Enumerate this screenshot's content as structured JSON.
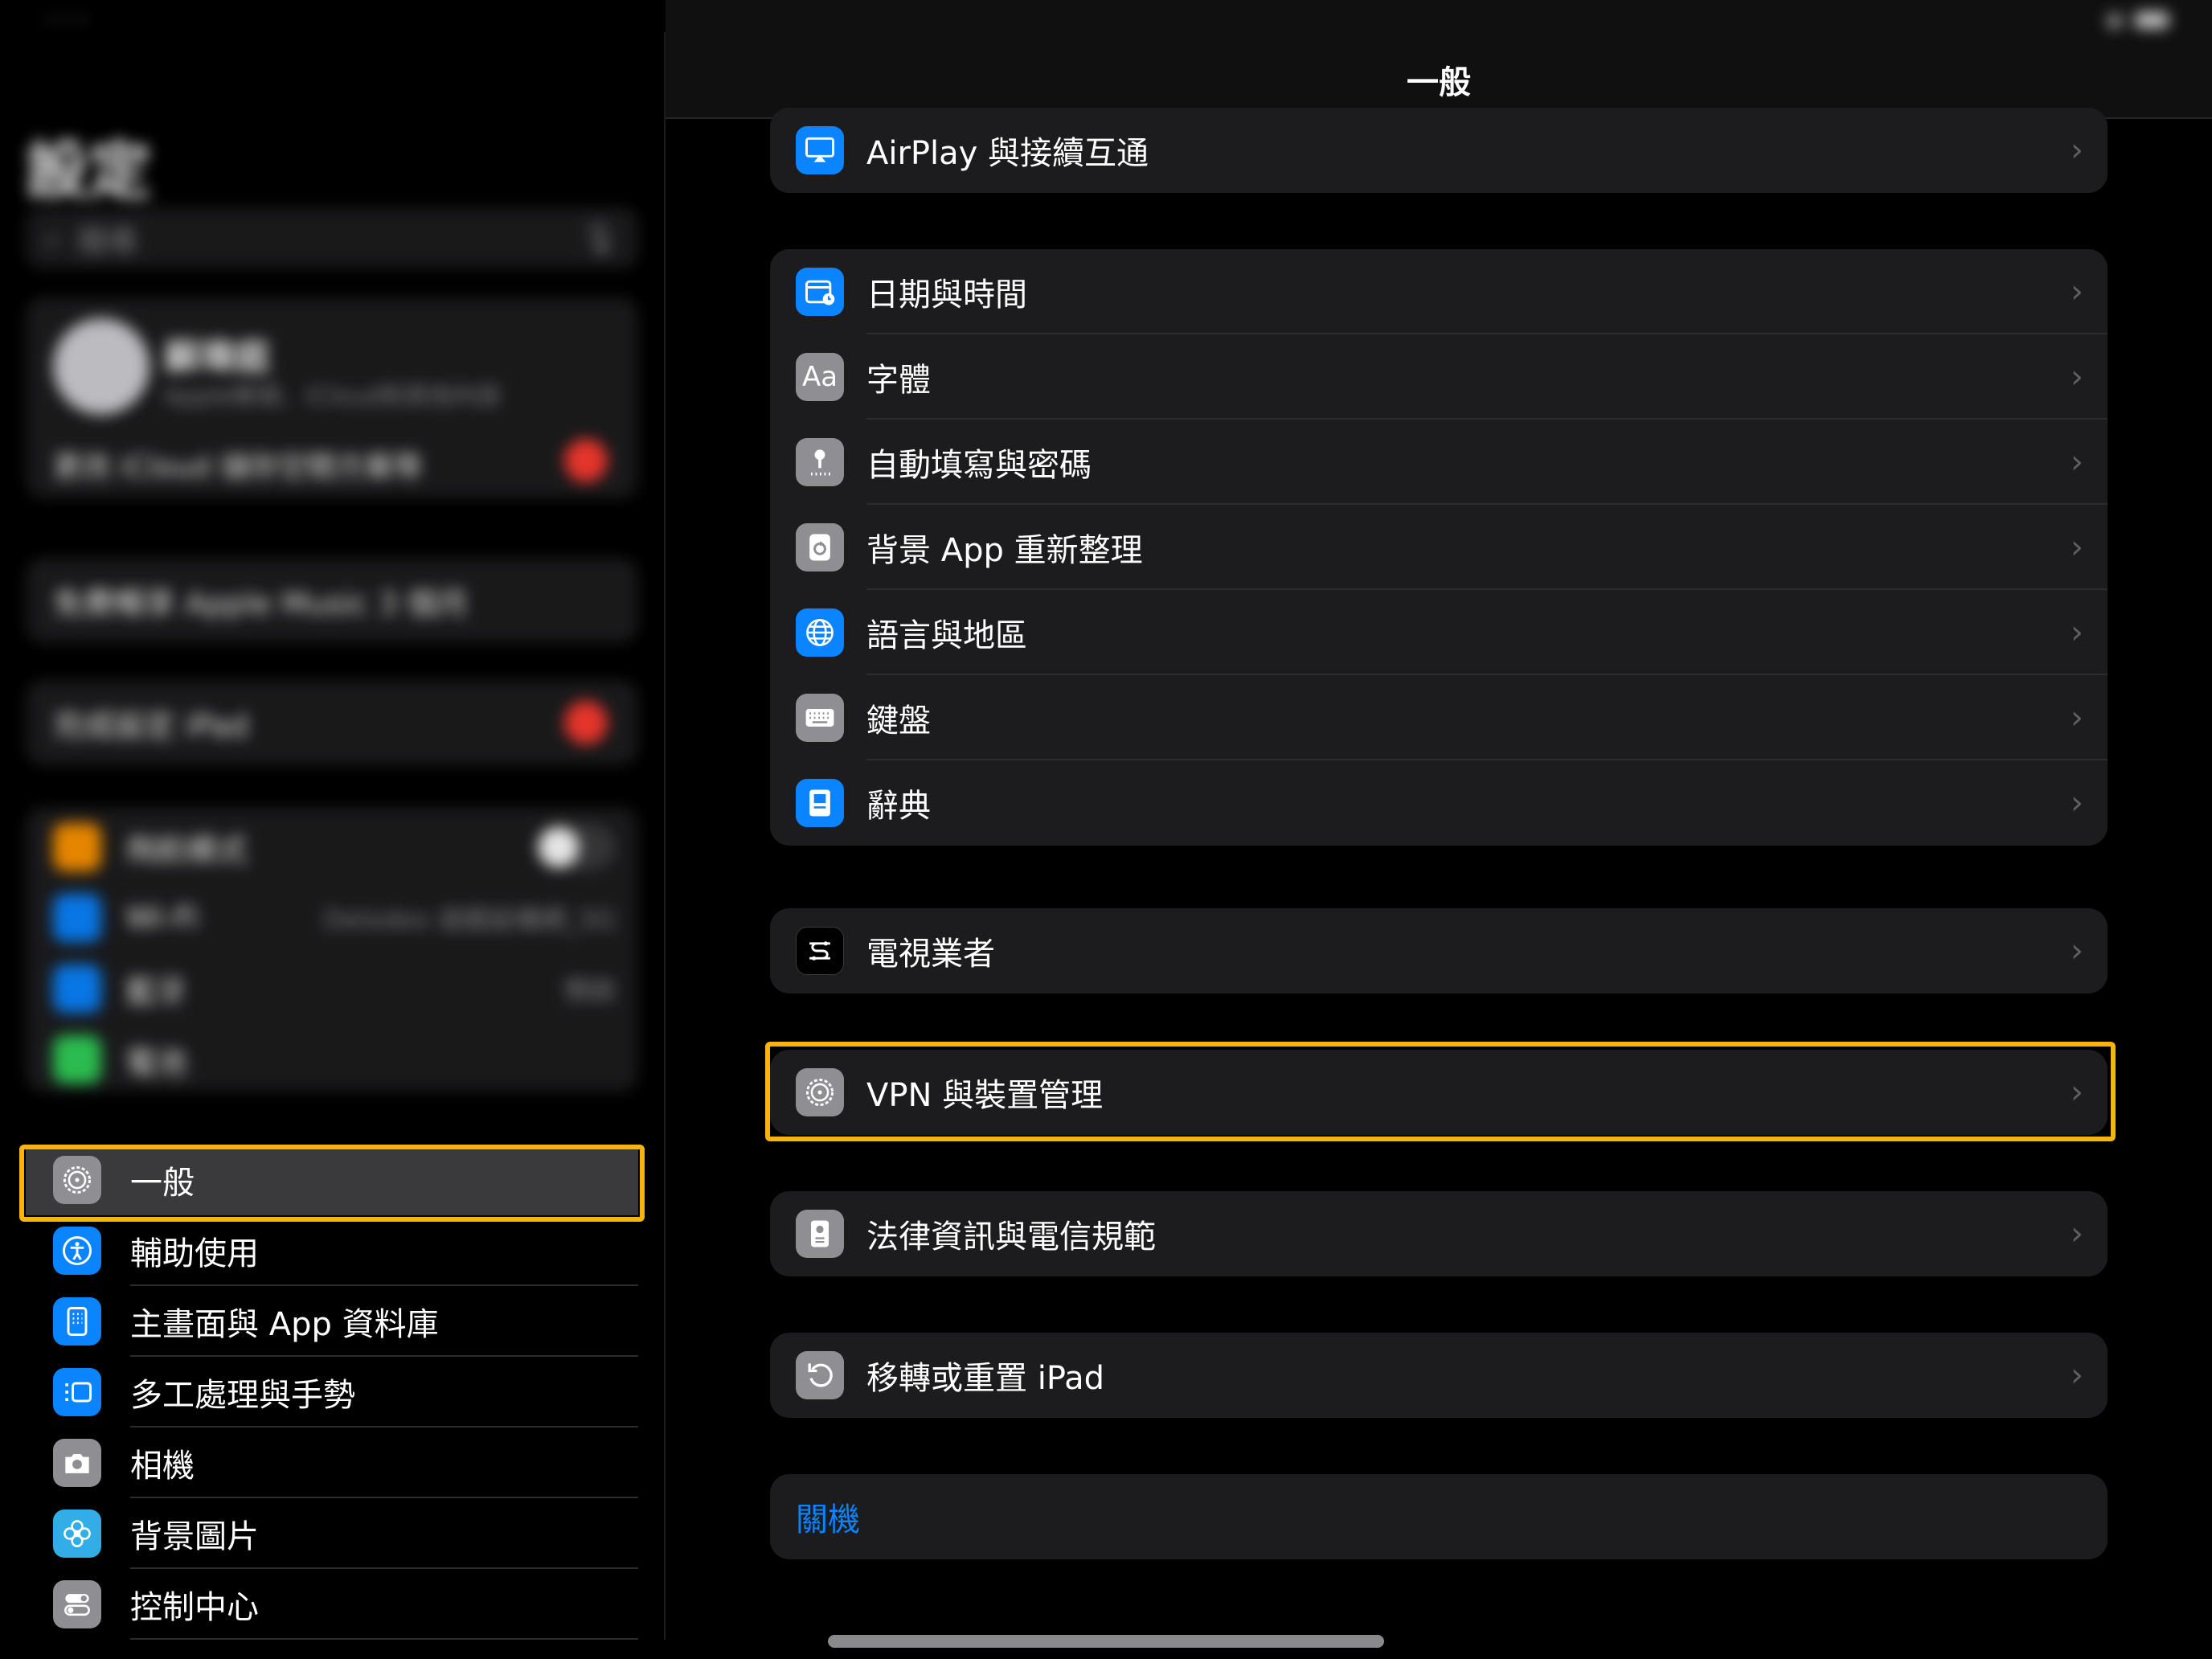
{
  "sidebar": {
    "title": "設定",
    "search_placeholder": "搜尋",
    "account": {
      "name": "蘇瑋庭",
      "subtitle": "Apple帳號、iCloud和其他內容",
      "notice": "更改 iCloud 儲存空間方案等"
    },
    "promo": "免費暢享 Apple Music 3 個月",
    "setup": "完成設定 iPad",
    "connectivity": [
      {
        "label": "飛航模式",
        "icon": "airplane-icon",
        "color": "#ff9500"
      },
      {
        "label": "Wi-Fi",
        "value": "Delodeo 遊戲設備網_5G",
        "icon": "wifi-icon",
        "color": "#0a84ff"
      },
      {
        "label": "藍牙",
        "value": "開啟",
        "icon": "bluetooth-icon",
        "color": "#0a84ff"
      },
      {
        "label": "電池",
        "icon": "battery-icon",
        "color": "#30d158"
      }
    ],
    "items": [
      {
        "label": "一般",
        "icon": "gear-icon",
        "color": "#8e8e93",
        "selected": true
      },
      {
        "label": "輔助使用",
        "icon": "accessibility-icon",
        "color": "#0a84ff"
      },
      {
        "label": "主畫面與 App 資料庫",
        "icon": "home-screen-icon",
        "color": "#0a84ff"
      },
      {
        "label": "多工處理與手勢",
        "icon": "multitasking-icon",
        "color": "#0a84ff"
      },
      {
        "label": "相機",
        "icon": "camera-icon",
        "color": "#8e8e93"
      },
      {
        "label": "背景圖片",
        "icon": "wallpaper-icon",
        "color": "#32ade6"
      },
      {
        "label": "控制中心",
        "icon": "control-center-icon",
        "color": "#8e8e93"
      }
    ]
  },
  "main": {
    "title": "一般",
    "groups": [
      [
        {
          "label": "AirPlay 與接續互通",
          "icon": "airplay-icon",
          "color": "#0a84ff"
        }
      ],
      [
        {
          "label": "日期與時間",
          "icon": "calendar-clock-icon",
          "color": "#0a84ff"
        },
        {
          "label": "字體",
          "icon": "font-icon",
          "color": "#8e8e93"
        },
        {
          "label": "自動填寫與密碼",
          "icon": "key-icon",
          "color": "#8e8e93"
        },
        {
          "label": "背景 App 重新整理",
          "icon": "refresh-icon",
          "color": "#8e8e93"
        },
        {
          "label": "語言與地區",
          "icon": "globe-icon",
          "color": "#0a84ff"
        },
        {
          "label": "鍵盤",
          "icon": "keyboard-icon",
          "color": "#8e8e93"
        },
        {
          "label": "辭典",
          "icon": "dictionary-icon",
          "color": "#0a84ff"
        }
      ],
      [
        {
          "label": "電視業者",
          "icon": "tv-provider-icon",
          "color": "#000000"
        }
      ],
      [
        {
          "label": "VPN 與裝置管理",
          "icon": "gear-icon",
          "color": "#8e8e93"
        }
      ],
      [
        {
          "label": "法律資訊與電信規範",
          "icon": "document-icon",
          "color": "#8e8e93"
        }
      ],
      [
        {
          "label": "移轉或重置 iPad",
          "icon": "reset-icon",
          "color": "#8e8e93"
        }
      ]
    ],
    "shutdown": "關機"
  },
  "colors": {
    "accent": "#0a84ff",
    "highlight": "#f5b50a"
  }
}
